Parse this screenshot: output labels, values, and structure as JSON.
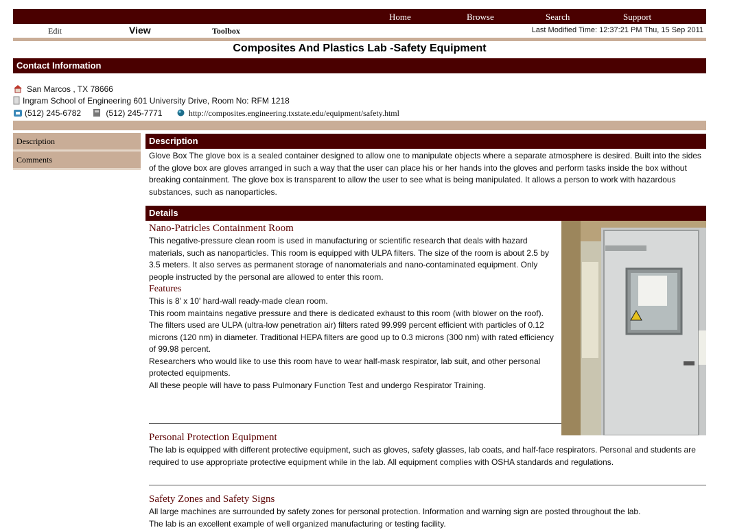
{
  "topnav": {
    "home": "Home",
    "browse": "Browse",
    "search": "Search",
    "support": "Support"
  },
  "subnav": {
    "edit": "Edit",
    "view": "View",
    "toolbox": "Toolbox",
    "last_modified": "Last Modified Time: 12:37:21 PM Thu, 15 Sep 2011"
  },
  "page_title": "Composites And Plastics Lab -Safety Equipment",
  "contact": {
    "header": "Contact Information",
    "city": "San Marcos , TX 78666",
    "address": "Ingram School of Engineering 601 University Drive, Room No: RFM 1218",
    "phone": "(512) 245-6782",
    "fax": "(512) 245-7771",
    "url": "http://composites.engineering.txstate.edu/equipment/safety.html"
  },
  "sidebar": {
    "items": [
      {
        "label": "Description"
      },
      {
        "label": "Comments"
      }
    ]
  },
  "description": {
    "header": "Description",
    "text": "Glove Box The glove box is a sealed container designed to allow one to manipulate objects where a separate atmosphere is desired. Built into the sides of the glove box are gloves arranged in such a way that the user can place his or her hands into the gloves and perform tasks inside the box without breaking containment. The glove box is transparent to allow the user to see what is being manipulated. It allows a person to work with hazardous substances, such as nanoparticles."
  },
  "details": {
    "header": "Details",
    "room_title": "Nano-Patricles Containment Room",
    "room_text": "This negative-pressure clean room is used in manufacturing or scientific research that deals with hazard materials, such as nanoparticles. This room is equipped with ULPA filters. The size of the room is about 2.5 by 3.5 meters. It also serves as permanent storage of nanomaterials and nano-contaminated equipment. Only people instructed by the personal are allowed to enter this room.",
    "features_title": "Features",
    "features": [
      "This is 8' x 10' hard-wall ready-made clean room.",
      "This room maintains negative pressure and there is dedicated exhaust to this room (with blower on the roof).",
      "The filters used are ULPA (ultra-low penetration air) filters rated 99.999 percent efficient with particles of 0.12 microns (120 nm) in diameter. Traditional HEPA filters are good up to 0.3 microns (300 nm) with rated efficiency of 99.98 percent.",
      "Researchers who would like to use this room have to wear half-mask respirator, lab suit, and other personal protected equipments.",
      "All these people will have to pass Pulmonary Function Test and undergo Respirator Training."
    ],
    "ppe_title": "Personal Protection Equipment",
    "ppe_text": "The lab is equipped with different protective equipment, such as gloves, safety glasses, lab coats, and half-face respirators. Personal and students are required to use appropriate protective equipment while in the lab. All equipment complies with OSHA standards and regulations.",
    "zones_title": "Safety Zones and Safety Signs",
    "zones_text_1": "All large machines are surrounded by safety zones for personal protection. Information and warning sign are posted throughout the lab.",
    "zones_text_2": "The lab is an excellent example of well organized manufacturing or testing facility."
  },
  "colors": {
    "maroon": "#4a0000",
    "tan": "#c9ad97",
    "heading_red": "#5a0000"
  }
}
